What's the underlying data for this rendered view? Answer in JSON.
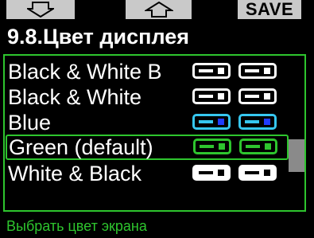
{
  "softkeys": {
    "left_icon": "arrow-down-icon",
    "middle_icon": "arrow-up-icon",
    "right_label": "SAVE"
  },
  "title": "9.8.Цвет дисплея",
  "options": [
    {
      "label": "Black & White B",
      "icon_style": "mono",
      "selected": false
    },
    {
      "label": "Black & White",
      "icon_style": "mono",
      "selected": false
    },
    {
      "label": "Blue",
      "icon_style": "blue",
      "selected": false
    },
    {
      "label": "Green (default)",
      "icon_style": "green",
      "selected": true
    },
    {
      "label": "White & Black",
      "icon_style": "inverted",
      "selected": false
    }
  ],
  "scrollbar": {
    "position_fraction": 0.55
  },
  "hint": "Выбрать цвет экрана",
  "colors": {
    "accent_green": "#2ec52e",
    "softkey_gray": "#c9c9c9",
    "blue_frame": "#36c7f0",
    "blue_square": "#1f3cff"
  }
}
